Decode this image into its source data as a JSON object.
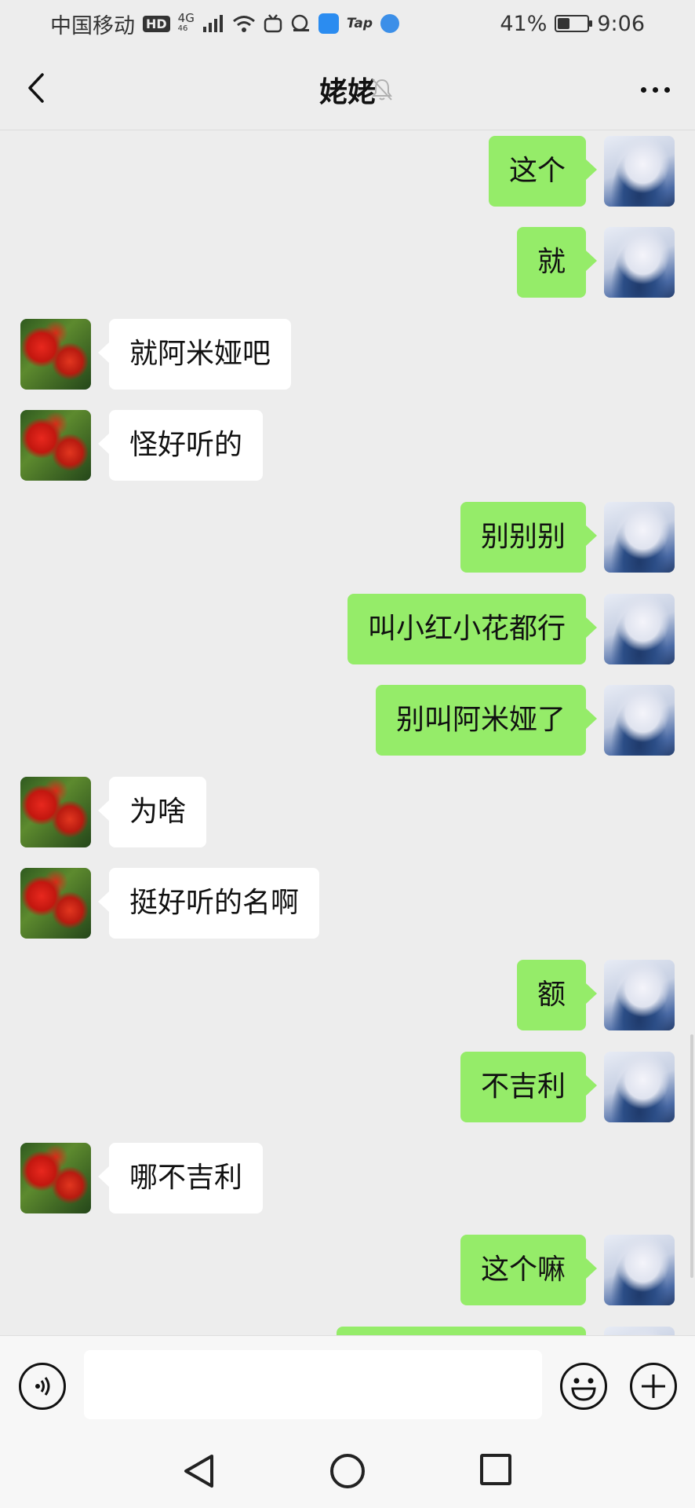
{
  "status_bar": {
    "carrier": "中国移动",
    "hd": "HD",
    "network_top": "4G",
    "network_bottom": "46",
    "tap": "Tap",
    "battery_text": "41%",
    "battery_level": 0.41,
    "time": "9:06"
  },
  "header": {
    "title": "姥姥",
    "muted": true
  },
  "messages": [
    {
      "side": "out",
      "text": "这个"
    },
    {
      "side": "out",
      "text": "就"
    },
    {
      "side": "in",
      "text": "就阿米娅吧"
    },
    {
      "side": "in",
      "text": "怪好听的"
    },
    {
      "side": "out",
      "text": "别别别"
    },
    {
      "side": "out",
      "text": "叫小红小花都行"
    },
    {
      "side": "out",
      "text": "别叫阿米娅了"
    },
    {
      "side": "in",
      "text": "为啥"
    },
    {
      "side": "in",
      "text": "挺好听的名啊"
    },
    {
      "side": "out",
      "text": "额"
    },
    {
      "side": "out",
      "text": "不吉利"
    },
    {
      "side": "in",
      "text": "哪不吉利"
    },
    {
      "side": "out",
      "text": "这个嘛"
    },
    {
      "side": "out",
      "text": ""
    }
  ],
  "input": {
    "value": "",
    "placeholder": ""
  },
  "icons": {
    "back": "chevron-left-icon",
    "mute": "bell-off-icon",
    "more": "more-dots-icon",
    "voice": "voice-icon",
    "emoji": "emoji-icon",
    "plus": "plus-icon"
  },
  "colors": {
    "outgoing_bubble": "#95ec69",
    "incoming_bubble": "#ffffff",
    "chat_background": "#ededed"
  }
}
